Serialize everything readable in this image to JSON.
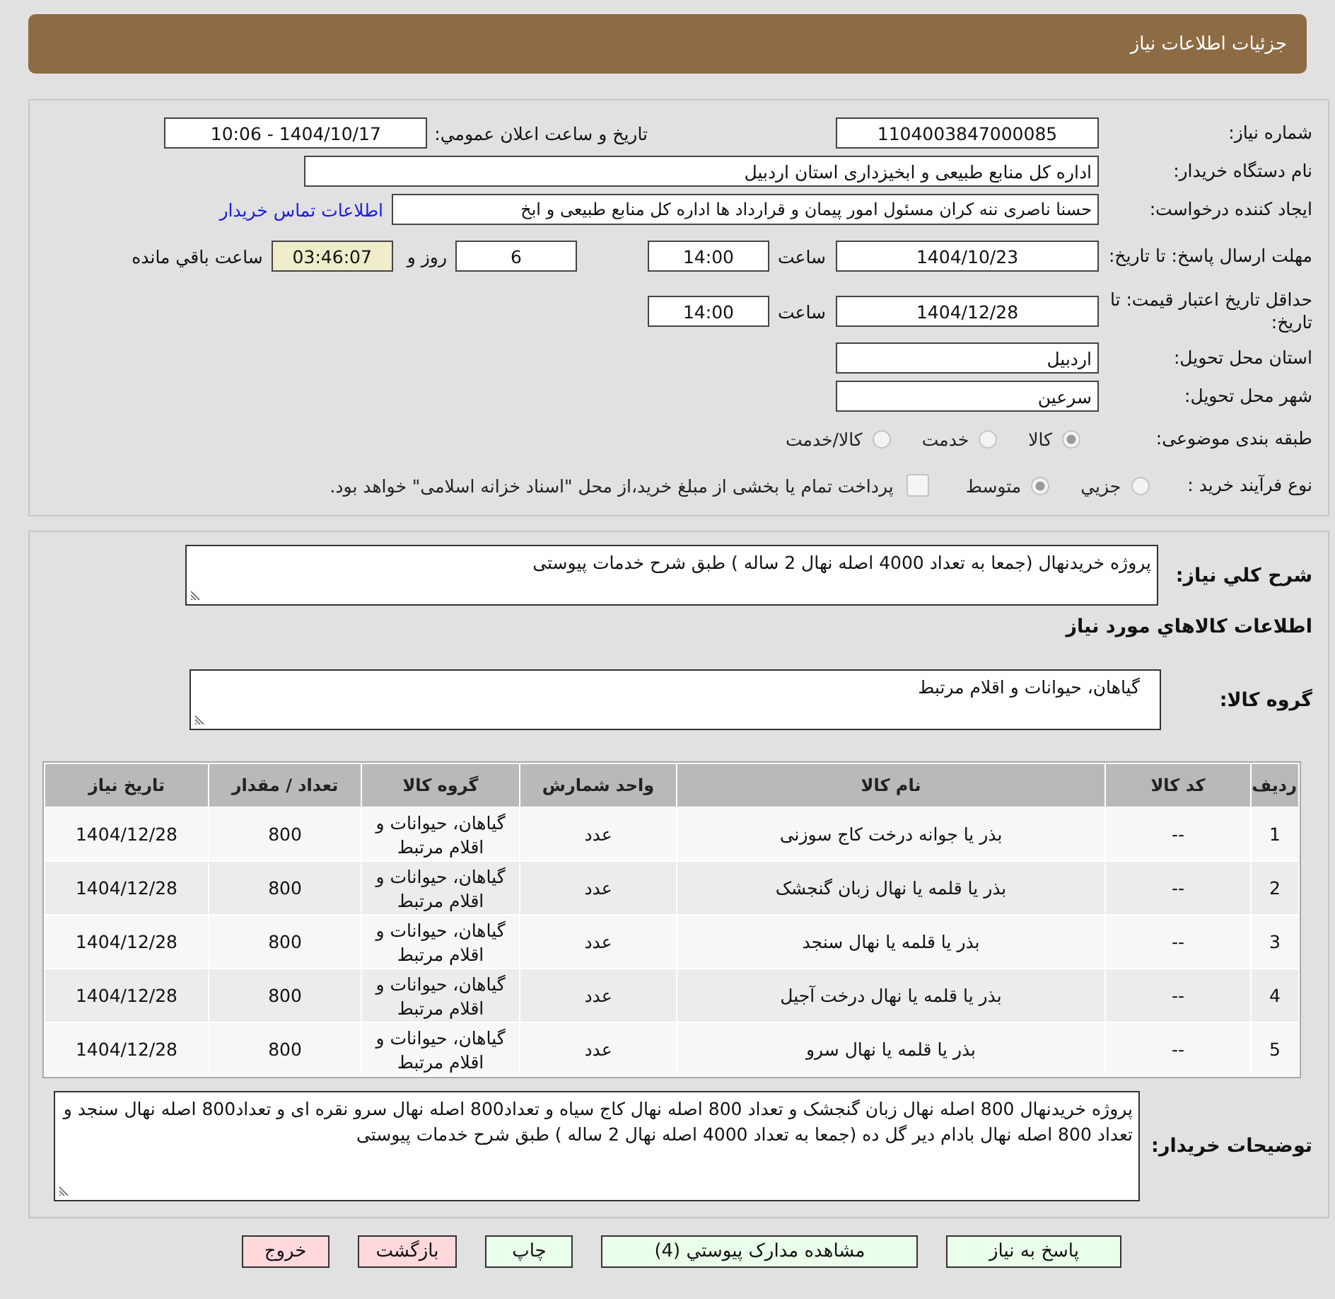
{
  "header": {
    "title": "جزئیات اطلاعات نیاز"
  },
  "details": {
    "need_number": {
      "label": "شماره نیاز:",
      "value": "1104003847000085"
    },
    "announcement": {
      "label": "تاریخ و ساعت اعلان عمومي:",
      "value": "1404/10/17 - 10:06"
    },
    "buyer_org": {
      "label": "نام دستگاه خریدار:",
      "value": "اداره کل منابع طبیعی و ابخیزداری استان اردبیل"
    },
    "creator": {
      "label": "ایجاد کننده درخواست:",
      "value": "حسنا ناصری ننه کران مسئول امور پیمان و قرارداد ها اداره کل منابع طبیعی و ابخ",
      "link": "اطلاعات تماس خریدار"
    },
    "response_deadline": {
      "label": "مهلت ارسال پاسخ: تا تاریخ:",
      "date": "1404/10/23",
      "time_label": "ساعت",
      "time": "14:00",
      "days": "6",
      "days_label": "روز و",
      "remaining": "03:46:07",
      "remaining_label": "ساعت باقي مانده"
    },
    "price_validity": {
      "label": "حداقل تاریخ اعتبار قیمت: تا تاریخ:",
      "date": "1404/12/28",
      "time_label": "ساعت",
      "time": "14:00"
    },
    "province": {
      "label": "استان محل تحویل:",
      "value": "اردبیل"
    },
    "city": {
      "label": "شهر محل تحویل:",
      "value": "سرعین"
    },
    "category": {
      "label": "طبقه بندی موضوعی:",
      "options": [
        {
          "label": "کالا",
          "selected": true
        },
        {
          "label": "خدمت",
          "selected": false
        },
        {
          "label": "کالا/خدمت",
          "selected": false
        }
      ]
    },
    "process": {
      "label": "نوع فرآیند خرید :",
      "options": [
        {
          "label": "جزيي",
          "selected": false
        },
        {
          "label": "متوسط",
          "selected": true
        }
      ],
      "treasury": {
        "checked": false,
        "text": "پرداخت تمام یا بخشی از مبلغ خرید،از محل \"اسناد خزانه اسلامی\" خواهد بود."
      }
    }
  },
  "summary": {
    "label": "شرح کلي نیاز:",
    "value": "پروژه خریدنهال (جمعا به تعداد 4000 اصله نهال 2 ساله ) طبق شرح خدمات پیوستی"
  },
  "goods": {
    "heading": "اطلاعات کالاهاي مورد نیاز",
    "group_label": "گروه کالا:",
    "group_value": "گیاهان، حیوانات و اقلام مرتبط",
    "table": {
      "columns": [
        "ردیف",
        "کد کالا",
        "نام کالا",
        "واحد شمارش",
        "گروه کالا",
        "تعداد / مقدار",
        "تاریخ نیاز"
      ],
      "rows": [
        [
          "1",
          "--",
          "بذر یا جوانه درخت کاج سوزنی",
          "عدد",
          "گیاهان، حیوانات و اقلام مرتبط",
          "800",
          "1404/12/28"
        ],
        [
          "2",
          "--",
          "بذر یا قلمه یا نهال زبان گنجشک",
          "عدد",
          "گیاهان، حیوانات و اقلام مرتبط",
          "800",
          "1404/12/28"
        ],
        [
          "3",
          "--",
          "بذر یا قلمه یا نهال سنجد",
          "عدد",
          "گیاهان، حیوانات و اقلام مرتبط",
          "800",
          "1404/12/28"
        ],
        [
          "4",
          "--",
          "بذر یا قلمه یا نهال درخت آجیل",
          "عدد",
          "گیاهان، حیوانات و اقلام مرتبط",
          "800",
          "1404/12/28"
        ],
        [
          "5",
          "--",
          "بذر یا قلمه یا نهال سرو",
          "عدد",
          "گیاهان، حیوانات و اقلام مرتبط",
          "800",
          "1404/12/28"
        ]
      ]
    }
  },
  "buyer_notes": {
    "label": "توضیحات خریدار:",
    "value": "پروژه خریدنهال 800 اصله نهال زبان گنجشک و تعداد 800 اصله نهال کاج سیاه و تعداد800 اصله نهال سرو نقره ای و تعداد800 اصله نهال سنجد و تعداد 800 اصله نهال بادام دیر گل ده (جمعا به تعداد 4000 اصله نهال 2 ساله ) طبق شرح خدمات پیوستی"
  },
  "buttons": [
    {
      "label": "پاسخ به نیاز",
      "kind": "action"
    },
    {
      "label": "مشاهده مدارک پیوستي (4)",
      "kind": "action"
    },
    {
      "label": "چاپ",
      "kind": "action"
    },
    {
      "label": "بازگشت",
      "kind": "exit"
    },
    {
      "label": "خروج",
      "kind": "exit"
    }
  ]
}
